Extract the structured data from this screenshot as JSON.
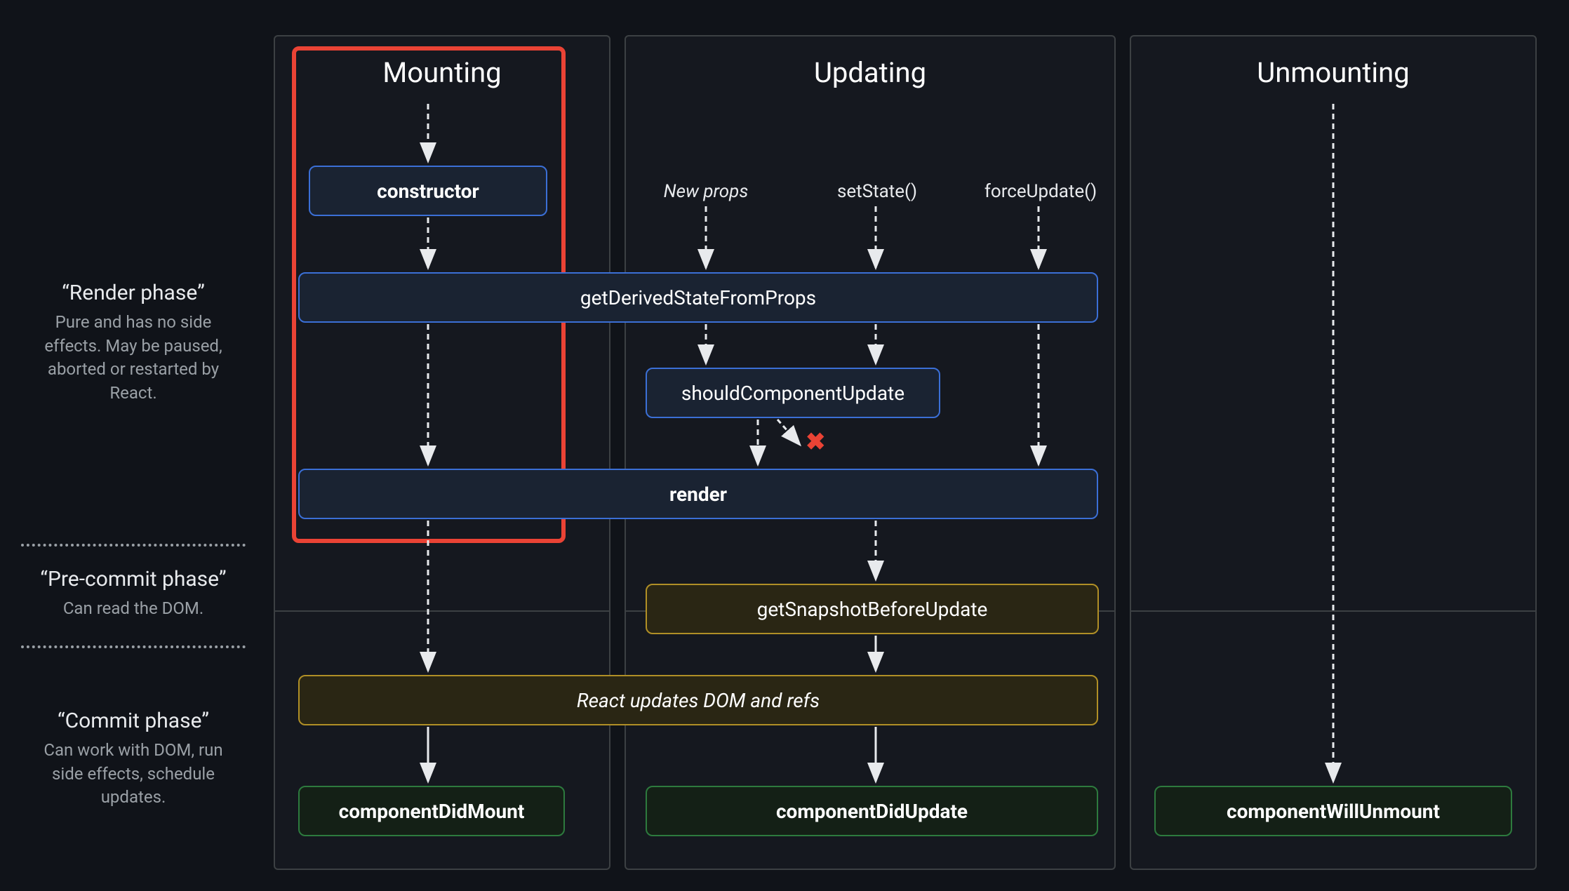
{
  "columns": {
    "mounting": "Mounting",
    "updating": "Updating",
    "unmounting": "Unmounting"
  },
  "phases": {
    "render": {
      "title": "“Render phase”",
      "desc": "Pure and has no side effects. May be paused, aborted or restarted by React."
    },
    "precommit": {
      "title": "“Pre-commit phase”",
      "desc": "Can read the DOM."
    },
    "commit": {
      "title": "“Commit phase”",
      "desc": "Can work with DOM, run side effects, schedule updates."
    }
  },
  "triggers": {
    "newprops": "New props",
    "setstate": "setState()",
    "forceupdate": "forceUpdate()"
  },
  "boxes": {
    "constructor": "constructor",
    "gdsfp": "getDerivedStateFromProps",
    "scu": "shouldComponentUpdate",
    "render": "render",
    "gsbu": "getSnapshotBeforeUpdate",
    "reactupdates": "React updates DOM and refs",
    "cdm": "componentDidMount",
    "cdu": "componentDidUpdate",
    "cwu": "componentWillUnmount"
  }
}
